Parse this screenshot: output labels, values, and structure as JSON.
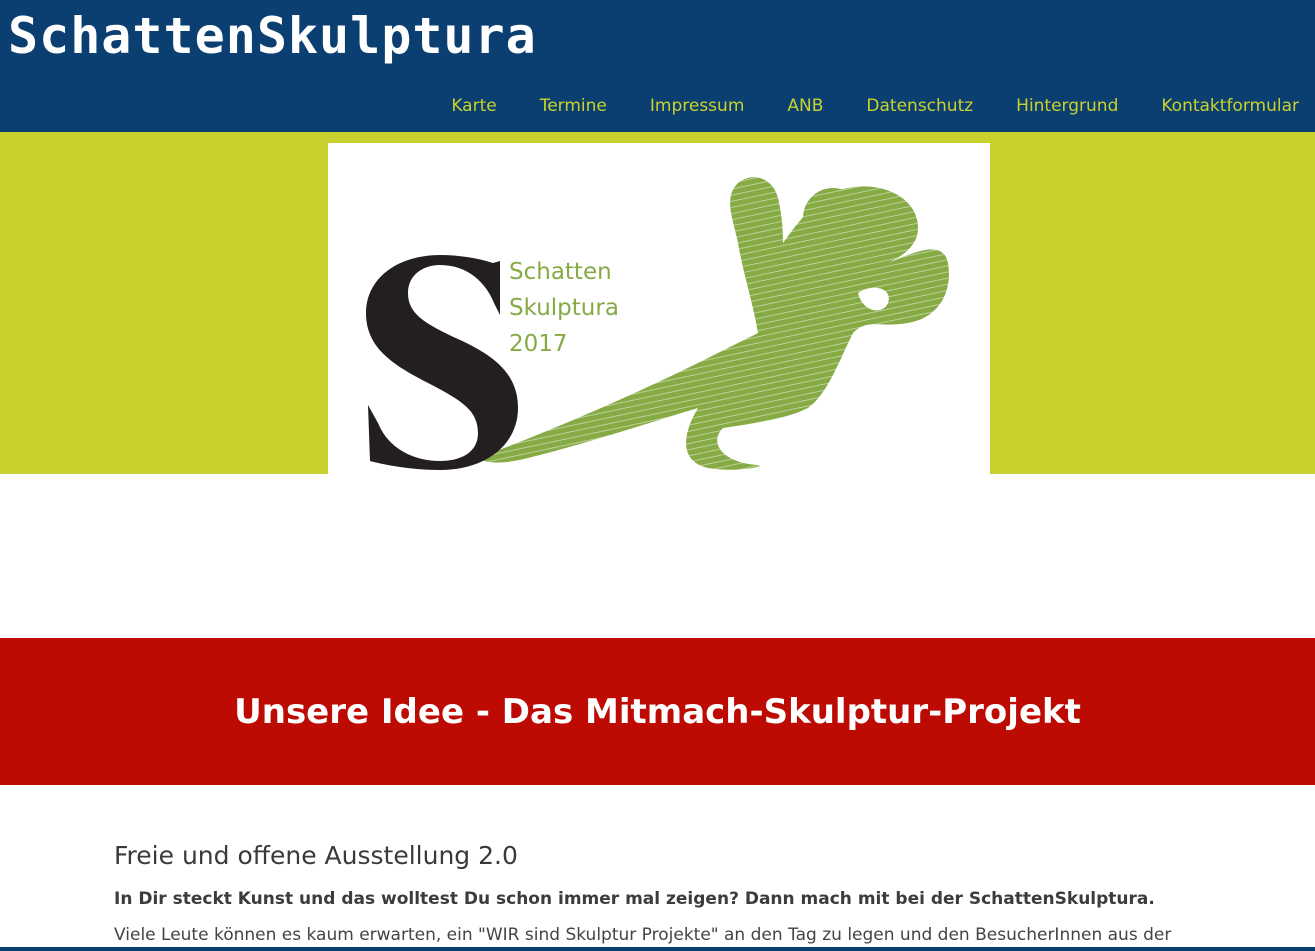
{
  "header": {
    "site_title": "SchattenSkulptura",
    "nav": [
      {
        "label": "Karte"
      },
      {
        "label": "Termine"
      },
      {
        "label": "Impressum"
      },
      {
        "label": "ANB"
      },
      {
        "label": "Datenschutz"
      },
      {
        "label": "Hintergrund"
      },
      {
        "label": "Kontaktformular"
      }
    ]
  },
  "logo": {
    "line1": "Schatten",
    "line2": "Skulptura",
    "line3": "2017"
  },
  "banner": {
    "title": "Unsere Idee - Das Mitmach-Skulptur-Projekt"
  },
  "content": {
    "heading": "Freie und offene Ausstellung 2.0",
    "lead": "In Dir steckt Kunst und das wolltest Du schon immer mal zeigen? Dann mach mit bei der SchattenSkulptura.",
    "text": "Viele Leute können es kaum erwarten, ein \"WIR sind Skulptur Projekte\" an den Tag zu legen und den BesucherInnen aus der"
  },
  "colors": {
    "header_bg": "#0b3f72",
    "nav_link": "#c9d22c",
    "hero_bg": "#c8d12e",
    "banner_bg": "#bd0a02",
    "logo_green": "#86ab45"
  }
}
